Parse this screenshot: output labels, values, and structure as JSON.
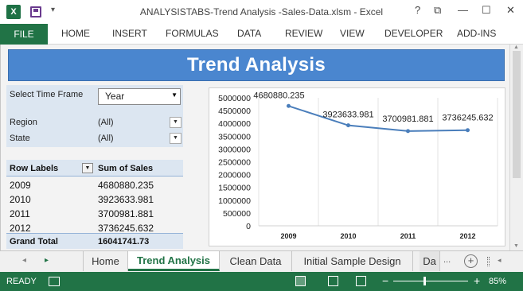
{
  "window": {
    "title": "ANALYSISTABS-Trend Analysis -Sales-Data.xlsm - Excel",
    "app_icon_label": "X",
    "help_label": "?",
    "restore_label": "⧉",
    "minimize_label": "—",
    "maximize_label": "☐",
    "close_label": "✕"
  },
  "ribbon": {
    "file_label": "FILE",
    "tabs": [
      "HOME",
      "INSERT",
      "FORMULAS",
      "DATA",
      "REVIEW",
      "VIEW",
      "DEVELOPER",
      "ADD-INS"
    ]
  },
  "banner": {
    "title": "Trend Analysis"
  },
  "slicer": {
    "time_frame_label": "Select Time Frame",
    "time_frame_value": "Year",
    "region_label": "Region",
    "region_value": "(All)",
    "state_label": "State",
    "state_value": "(All)"
  },
  "pivot": {
    "col_row_labels": "Row Labels",
    "col_sum": "Sum of Sales",
    "rows": [
      {
        "label": "2009",
        "value": "4680880.235"
      },
      {
        "label": "2010",
        "value": "3923633.981"
      },
      {
        "label": "2011",
        "value": "3700981.881"
      },
      {
        "label": "2012",
        "value": "3736245.632"
      }
    ],
    "total_label": "Grand Total",
    "total_value": "16041741.73"
  },
  "chart_data": {
    "type": "line",
    "categories": [
      "2009",
      "2010",
      "2011",
      "2012"
    ],
    "series": [
      {
        "values": [
          4680880.235,
          3923633.981,
          3700981.881,
          3736245.632
        ]
      }
    ],
    "data_labels": [
      "4680880.235",
      "3923633.981",
      "3700981.881",
      "3736245.632"
    ],
    "y_ticks": [
      "0",
      "500000",
      "1000000",
      "1500000",
      "2000000",
      "2500000",
      "3000000",
      "3500000",
      "4000000",
      "4500000",
      "5000000"
    ],
    "ylim": [
      0,
      5000000
    ],
    "grid": "vertical",
    "line_color": "#4a7ebb"
  },
  "sheet_tabs": {
    "prev_label": "◂",
    "next_label": "▸",
    "tabs": [
      "Home",
      "Trend Analysis",
      "Clean Data",
      "Initial Sample Design",
      "Da"
    ],
    "more_label": "...",
    "add_label": "+",
    "active": "Trend Analysis"
  },
  "status": {
    "ready": "READY",
    "zoom_minus": "−",
    "zoom_plus": "+",
    "zoom": "85%",
    "zoom_fraction": 0.42
  },
  "colors": {
    "accent": "#217346",
    "banner": "#4a86cf",
    "pivot_header": "#dce6f1"
  }
}
